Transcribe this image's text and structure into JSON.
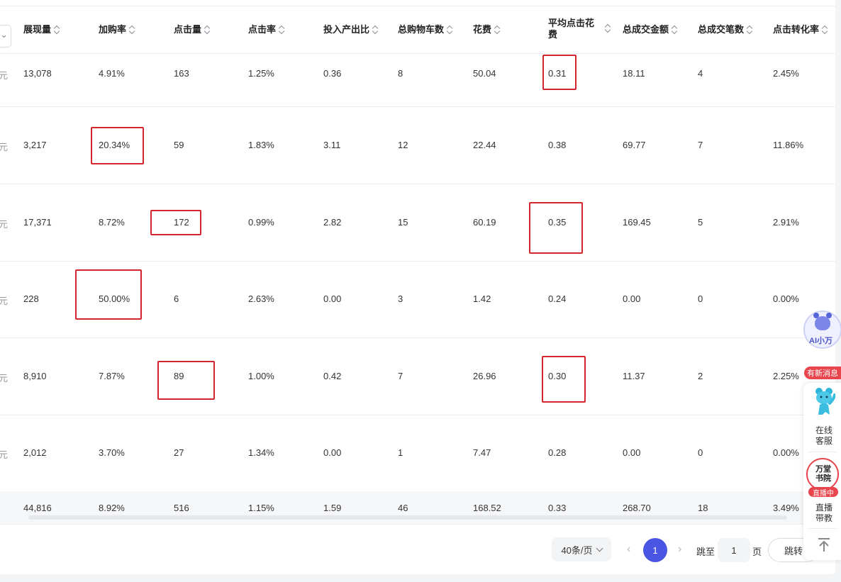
{
  "table": {
    "headers": [
      "展现量",
      "加购率",
      "点击量",
      "点击率",
      "投入产出比",
      "总购物车数",
      "花费",
      "平均点击花费",
      "总成交金额",
      "总成交笔数",
      "点击转化率"
    ],
    "header_second_line": {
      "avg_cpc": "费"
    },
    "header_first_line": {
      "avg_cpc": "平均点击花"
    },
    "row_prefix": "元",
    "rows": [
      [
        "13,078",
        "4.91%",
        "163",
        "1.25%",
        "0.36",
        "8",
        "50.04",
        "0.31",
        "18.11",
        "4",
        "2.45%"
      ],
      [
        "3,217",
        "20.34%",
        "59",
        "1.83%",
        "3.11",
        "12",
        "22.44",
        "0.38",
        "69.77",
        "7",
        "11.86%"
      ],
      [
        "17,371",
        "8.72%",
        "172",
        "0.99%",
        "2.82",
        "15",
        "60.19",
        "0.35",
        "169.45",
        "5",
        "2.91%"
      ],
      [
        "228",
        "50.00%",
        "6",
        "2.63%",
        "0.00",
        "3",
        "1.42",
        "0.24",
        "0.00",
        "0",
        "0.00%"
      ],
      [
        "8,910",
        "7.87%",
        "89",
        "1.00%",
        "0.42",
        "7",
        "26.96",
        "0.30",
        "11.37",
        "2",
        "2.25%"
      ],
      [
        "2,012",
        "3.70%",
        "27",
        "1.34%",
        "0.00",
        "1",
        "7.47",
        "0.28",
        "0.00",
        "0",
        "0.00%"
      ]
    ],
    "summary": [
      "44,816",
      "8.92%",
      "516",
      "1.15%",
      "1.59",
      "46",
      "168.52",
      "0.33",
      "268.70",
      "18",
      "3.49%"
    ]
  },
  "pagination": {
    "page_size": "40条/页",
    "current_page": "1",
    "jump_to": "跳至",
    "jump_value": "1",
    "page_unit": "页",
    "jump_button": "跳转"
  },
  "side": {
    "ai_label": "AI小万",
    "new_message": "有新消息",
    "service_label": "在线客服",
    "academy_label": "万堂书院",
    "live_badge": "直播中",
    "live_label": "直播带教"
  },
  "colors": {
    "highlight": "#d3262d",
    "accent": "#4b55e3",
    "badge": "#e8454d"
  }
}
